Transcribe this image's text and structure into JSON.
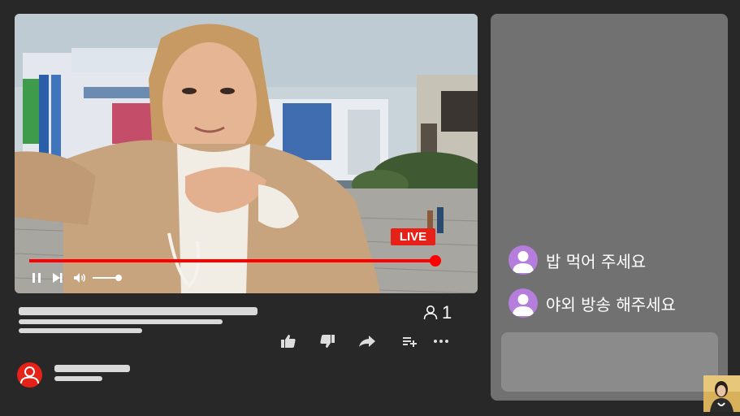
{
  "player": {
    "live_label": "LIVE",
    "progress": 1.0,
    "volume": 1.0,
    "controls": [
      "pause-icon",
      "skip-next-icon",
      "volume-icon"
    ],
    "accent_color": "#ff0000"
  },
  "video_info": {
    "viewer_count": "1",
    "actions": [
      "like-icon",
      "dislike-icon",
      "share-icon",
      "add-to-playlist-icon",
      "more-icon"
    ]
  },
  "chat": {
    "messages": [
      {
        "text": "밥 먹어 주세요",
        "avatar": "user-avatar-icon"
      },
      {
        "text": "야외 방송 해주세요",
        "avatar": "user-avatar-icon"
      }
    ]
  },
  "colors": {
    "background": "#282828",
    "chat_panel": "#717171",
    "chat_input": "#8b8b8b",
    "live_badge": "#e62117",
    "chat_avatar": "#b57edc",
    "placeholder": "#d9d9d9"
  }
}
